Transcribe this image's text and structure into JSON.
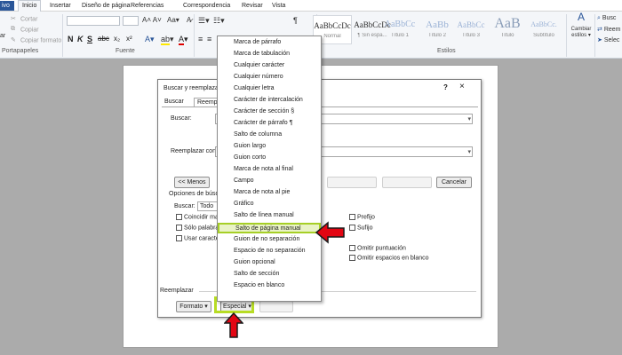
{
  "ribbon_tabs": {
    "file": "ivo",
    "home": "Inicio",
    "insert": "Insertar",
    "layout": "Diseño de página",
    "references": "Referencias",
    "mailings": "Correspondencia",
    "review": "Revisar",
    "view": "Vista"
  },
  "ribbon": {
    "clipboard": {
      "cut": "Cortar",
      "copy": "Copiar",
      "format_painter": "Copiar formato",
      "paste": "ar",
      "group_label": "Portapapeles"
    },
    "font": {
      "group_label": "Fuente"
    },
    "styles": {
      "group_label": "Estilos",
      "items": [
        {
          "sample": "AaBbCcDc",
          "name": "Normal"
        },
        {
          "sample": "AaBbCcDc",
          "name": "¶ Sin espa..."
        },
        {
          "sample": "AaBbCc",
          "name": "Título 1"
        },
        {
          "sample": "AaBb",
          "name": "Título 2"
        },
        {
          "sample": "AaBbCc",
          "name": "Título 3"
        },
        {
          "sample": "AaB",
          "name": "Título"
        },
        {
          "sample": "AaBbCc.",
          "name": "Subtítulo"
        }
      ],
      "change_styles": "Cambiar estilos",
      "change_styles_caret": "▾"
    },
    "editing": {
      "find": "Busc",
      "replace": "Reem",
      "select": "Selec"
    }
  },
  "dialog": {
    "title": "Buscar y reemplazar",
    "help": "?",
    "close": "×",
    "tabs": [
      "Buscar",
      "Reemplazar"
    ],
    "find_label": "Buscar:",
    "replace_label": "Reemplazar con:",
    "less_button": "<< Menos",
    "cancel_button": "Cancelar",
    "search_options_label": "Opciones de búsqueda",
    "search_label": "Buscar:",
    "search_value": "Todo",
    "checkboxes_left": [
      "Coincidir may",
      "Sólo palabras",
      "Usar caracteres"
    ],
    "checkboxes_right": [
      "Prefijo",
      "Sufijo",
      "Omitir puntuación",
      "Omitir espacios en blanco"
    ],
    "replace_section_label": "Reemplazar",
    "format_button": "Formato ▾",
    "special_button": "Especial ▾"
  },
  "special_menu": {
    "items": [
      "Marca de párrafo",
      "Marca de tabulación",
      "Cualquier carácter",
      "Cualquier número",
      "Cualquier letra",
      "Carácter de intercalación",
      "Carácter de sección §",
      "Carácter de párrafo ¶",
      "Salto de columna",
      "Guion largo",
      "Guion corto",
      "Marca de nota al final",
      "Campo",
      "Marca de nota al pie",
      "Gráfico",
      "Salto de línea manual",
      "Salto de página manual",
      "Guion de no separación",
      "Espacio de no separación",
      "Guion opcional",
      "Salto de sección",
      "Espacio en blanco"
    ],
    "highlighted_index": 16
  },
  "colors": {
    "highlight_green": "#b7dc24",
    "arrow_red": "#e30613",
    "word_blue": "#2a5699"
  }
}
